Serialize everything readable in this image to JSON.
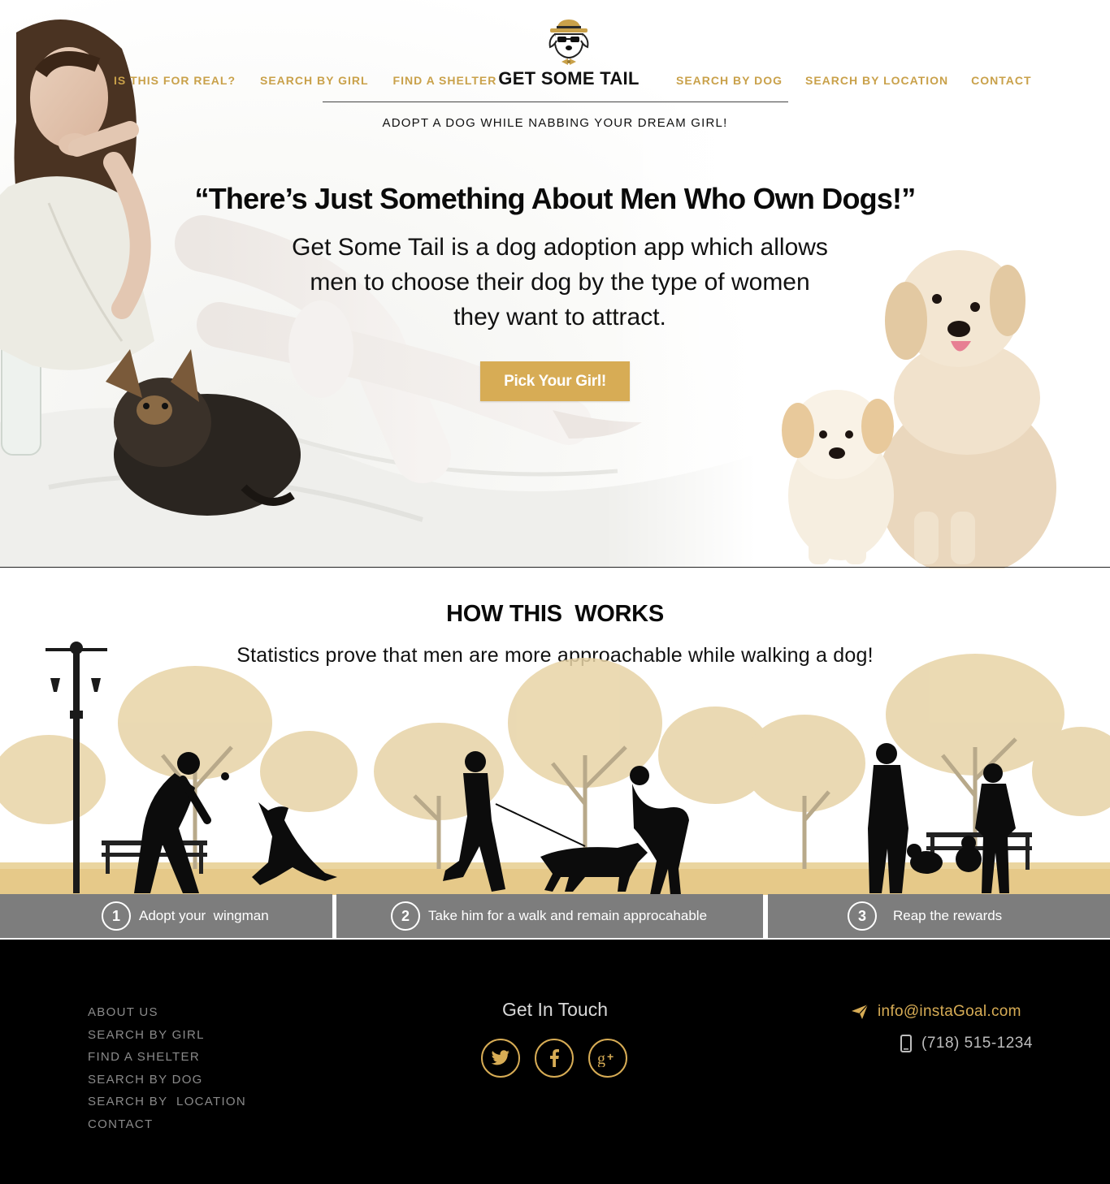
{
  "colors": {
    "accent": "#d7ac55",
    "nav_text": "#c9a14a",
    "step_bar": "#7d7d7d",
    "footer_bg": "#000000",
    "footer_link": "#8a8a8a"
  },
  "header": {
    "nav_left": [
      "IS THIS FOR REAL?",
      "SEARCH BY GIRL",
      "FIND A SHELTER"
    ],
    "brand": "GET SOME TAIL",
    "nav_right": [
      "SEARCH BY DOG",
      "SEARCH BY LOCATION",
      "CONTACT"
    ],
    "tagline": "ADOPT A DOG WHILE NABBING YOUR DREAM GIRL!",
    "logo_icon": "dog-with-hat-icon"
  },
  "hero": {
    "headline": "“There’s Just Something About Men Who Own Dogs!”",
    "intro": "Get Some Tail is a dog adoption app which allows men to choose their dog by the type of women they want to attract.",
    "cta_label": "Pick Your Girl!"
  },
  "how": {
    "title": "HOW THIS  WORKS",
    "subtitle": "Statistics prove that men are more approachable while walking a dog!",
    "steps": [
      {
        "num": "1",
        "label": "Adopt your  wingman"
      },
      {
        "num": "2",
        "label": "Take him for a walk and remain approcahable"
      },
      {
        "num": "3",
        "label": "Reap the rewards"
      }
    ]
  },
  "footer": {
    "links": [
      "ABOUT US",
      "SEARCH BY GIRL",
      "FIND A SHELTER",
      "SEARCH BY DOG",
      "SEARCH BY  LOCATION",
      "CONTACT"
    ],
    "get_in_touch": "Get In Touch",
    "social": [
      "twitter-icon",
      "facebook-icon",
      "google-plus-icon"
    ],
    "email": "info@instaGoal.com",
    "phone": "(718) 515-1234"
  }
}
